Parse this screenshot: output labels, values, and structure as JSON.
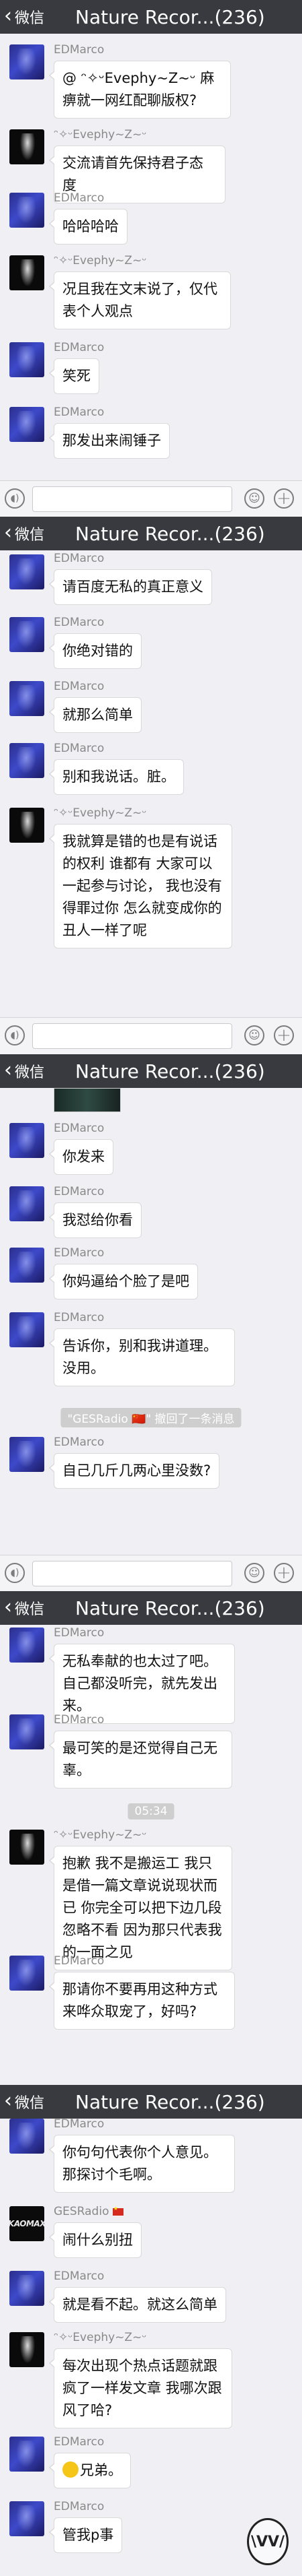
{
  "header": {
    "back_label": "微信",
    "title": "Nature Recor...(236)"
  },
  "senders": {
    "ed": "EDMarco",
    "z": "ᵔ✧ᵕEvephy~Z~ᵕ",
    "ges": "GESRadio"
  },
  "segments": [
    {
      "messages": [
        {
          "text": "@ ᵔ✧ᵕEvephy~Z~ᵕ 麻痹就一网红配聊版权?"
        },
        {
          "text": "交流请首先保持君子态度"
        },
        {
          "text": "哈哈哈哈"
        },
        {
          "text": "况且我在文末说了，仅代表个人观点"
        },
        {
          "text": "笑死"
        },
        {
          "text": "那发出来闹锤子"
        }
      ]
    },
    {
      "messages": [
        {
          "text": "请百度无私的真正意义"
        },
        {
          "text": "你绝对错的"
        },
        {
          "text": "就那么简单"
        },
        {
          "text": "别和我说话。脏。"
        },
        {
          "text": "我就算是错的也是有说话的权利 谁都有 大家可以一起参与讨论， 我也没有得罪过你 怎么就变成你的丑人一样了呢"
        }
      ]
    },
    {
      "messages": [
        {
          "text": "你发来"
        },
        {
          "text": "我怼给你看"
        },
        {
          "text": "你妈逼给个脸了是吧"
        },
        {
          "text": "告诉你，别和我讲道理。没用。"
        },
        {
          "text": "自己几斤几两心里没数?"
        }
      ],
      "system_notice": "\"GESRadio 🇨🇳\" 撤回了一条消息"
    },
    {
      "messages": [
        {
          "text": "无私奉献的也太过了吧。自己都没听完，就先发出来。"
        },
        {
          "text": "最可笑的是还觉得自己无辜。"
        },
        {
          "text": "抱歉 我不是搬运工 我只是借一篇文章说说现状而已 你完全可以把下边几段忽略不看 因为那只代表我的一面之见"
        },
        {
          "text": "那请你不要再用这种方式来哗众取宠了，好吗?"
        }
      ],
      "time": "05:34"
    },
    {
      "messages": [
        {
          "text": "你句句代表你个人意见。那探讨个毛啊。"
        },
        {
          "text": "闹什么别扭"
        },
        {
          "text": "就是看不起。就这么简单"
        },
        {
          "text": "每次出现个热点话题就跟疯了一样发文章 我哪次跟风了哈?"
        },
        {
          "text": "兄弟。"
        },
        {
          "text": "管我p事"
        }
      ]
    }
  ],
  "avatar_ges_text": "KAOMAX",
  "watermark_text": "\\VV/",
  "icons": {
    "back": "chevron-left-icon",
    "voice": "voice-icon",
    "emoji": "emoji-icon",
    "plus": "plus-icon"
  },
  "colors": {
    "topbar": "#393a3f",
    "background": "#efeff4"
  }
}
